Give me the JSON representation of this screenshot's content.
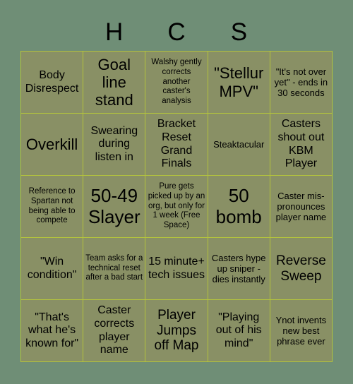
{
  "card": {
    "title_letters": [
      "",
      "H",
      "C",
      "S",
      ""
    ],
    "colors": {
      "background": "#6f8e76",
      "cell_fill": "#899065",
      "grid_line": "#b4c43c",
      "text": "#000000"
    },
    "grid": {
      "columns": 5,
      "rows": 5,
      "free_space_index": 12
    },
    "cells": [
      {
        "text": "Body Disrespect",
        "size": "md"
      },
      {
        "text": "Goal line stand",
        "size": "xl"
      },
      {
        "text": "Walshy gently corrects another caster's analysis",
        "size": "xs"
      },
      {
        "text": "\"Stellur MPV\"",
        "size": "xl"
      },
      {
        "text": "\"It's not over yet\" - ends in 30 seconds",
        "size": "sm"
      },
      {
        "text": "Overkill",
        "size": "xl"
      },
      {
        "text": "Swearing during listen in",
        "size": "md"
      },
      {
        "text": "Bracket Reset Grand Finals",
        "size": "md"
      },
      {
        "text": "Steaktacular",
        "size": "sm"
      },
      {
        "text": "Casters shout out KBM Player",
        "size": "md"
      },
      {
        "text": "Reference to Spartan not being able to compete",
        "size": "xs"
      },
      {
        "text": "50-49 Slayer",
        "size": "xxl"
      },
      {
        "text": "Pure gets picked up by an org, but only for 1 week (Free Space)",
        "size": "xs"
      },
      {
        "text": "50 bomb",
        "size": "xxl"
      },
      {
        "text": "Caster mis-pronounces player name",
        "size": "sm"
      },
      {
        "text": "\"Win condition\"",
        "size": "md"
      },
      {
        "text": "Team asks for a technical reset after a bad start",
        "size": "xs"
      },
      {
        "text": "15 minute+ tech issues",
        "size": "md"
      },
      {
        "text": "Casters hype up sniper - dies instantly",
        "size": "sm"
      },
      {
        "text": "Reverse Sweep",
        "size": "lg"
      },
      {
        "text": "\"That's what he's known for\"",
        "size": "md"
      },
      {
        "text": "Caster corrects player name",
        "size": "md"
      },
      {
        "text": "Player Jumps off Map",
        "size": "lg"
      },
      {
        "text": "\"Playing out of his mind\"",
        "size": "md"
      },
      {
        "text": "Ynot invents new best phrase ever",
        "size": "sm"
      }
    ]
  }
}
